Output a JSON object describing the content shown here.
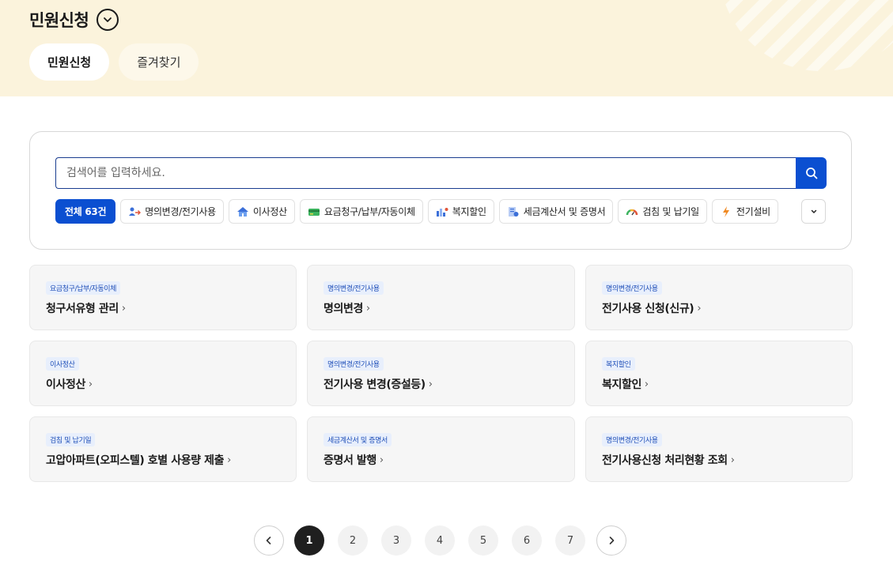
{
  "header": {
    "title": "민원신청",
    "tabs": [
      {
        "label": "민원신청",
        "active": true
      },
      {
        "label": "즐겨찾기",
        "active": false
      }
    ],
    "band_color": "#fbf3dc"
  },
  "search": {
    "placeholder": "검색어를 입력하세요.",
    "value": "",
    "button_color": "#0b4fd1"
  },
  "categories": [
    {
      "label": "전체 63건",
      "active": true,
      "icon": ""
    },
    {
      "label": "명의변경/전기사용",
      "active": false,
      "icon": "person-transfer-icon"
    },
    {
      "label": "이사정산",
      "active": false,
      "icon": "house-icon"
    },
    {
      "label": "요금청구/납부/자동이체",
      "active": false,
      "icon": "card-icon"
    },
    {
      "label": "복지할인",
      "active": false,
      "icon": "welfare-chart-icon"
    },
    {
      "label": "세금계산서 및 증명서",
      "active": false,
      "icon": "certificate-icon"
    },
    {
      "label": "검침 및 납기일",
      "active": false,
      "icon": "gauge-icon"
    },
    {
      "label": "전기설비",
      "active": false,
      "icon": "lightning-icon"
    }
  ],
  "cards": [
    {
      "tag": "요금청구/납부/자동이체",
      "title": "청구서유형 관리"
    },
    {
      "tag": "명의변경/전기사용",
      "title": "명의변경"
    },
    {
      "tag": "명의변경/전기사용",
      "title": "전기사용 신청(신규)"
    },
    {
      "tag": "이사정산",
      "title": "이사정산"
    },
    {
      "tag": "명의변경/전기사용",
      "title": "전기사용 변경(증설등)"
    },
    {
      "tag": "복지할인",
      "title": "복지할인"
    },
    {
      "tag": "검침 및 납기일",
      "title": "고압아파트(오피스텔) 호별 사용량 제출"
    },
    {
      "tag": "세금계산서 및 증명서",
      "title": "증명서 발행"
    },
    {
      "tag": "명의변경/전기사용",
      "title": "전기사용신청 처리현황 조회"
    }
  ],
  "pagination": {
    "pages": [
      "1",
      "2",
      "3",
      "4",
      "5",
      "6",
      "7"
    ],
    "current": "1"
  }
}
